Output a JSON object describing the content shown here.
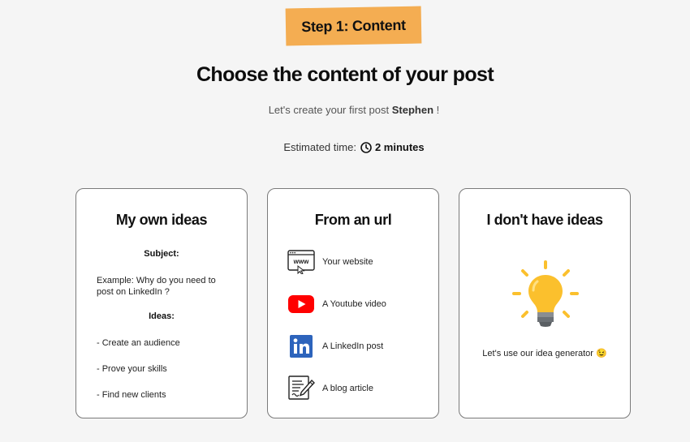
{
  "header": {
    "step_label": "Step 1: Content",
    "title": "Choose the content of your post",
    "greeting_prefix": "Let's create your first post",
    "user_name": "Stephen",
    "greeting_suffix": "!",
    "estimate_label": "Estimated time:",
    "estimate_value": "2 minutes"
  },
  "cards": {
    "own_ideas": {
      "title": "My own ideas",
      "subject_label": "Subject:",
      "subject_example": "Example: Why do you need to post on LinkedIn ?",
      "ideas_label": "Ideas:",
      "ideas": [
        "- Create an audience",
        "- Prove your skills",
        "- Find new clients"
      ]
    },
    "from_url": {
      "title": "From an url",
      "sources": [
        {
          "label": "Your website",
          "icon": "www-icon"
        },
        {
          "label": "A Youtube video",
          "icon": "youtube-icon"
        },
        {
          "label": "A LinkedIn post",
          "icon": "linkedin-icon"
        },
        {
          "label": "A blog article",
          "icon": "blog-article-icon"
        }
      ]
    },
    "no_ideas": {
      "title": "I don't have ideas",
      "generator_text": "Let's use our idea generator 😉",
      "icon": "lightbulb-icon"
    }
  },
  "colors": {
    "badge": "#f4ad52",
    "youtube_red": "#ff0000",
    "linkedin_blue": "#2d64bc",
    "bulb_yellow": "#fbc02d"
  }
}
